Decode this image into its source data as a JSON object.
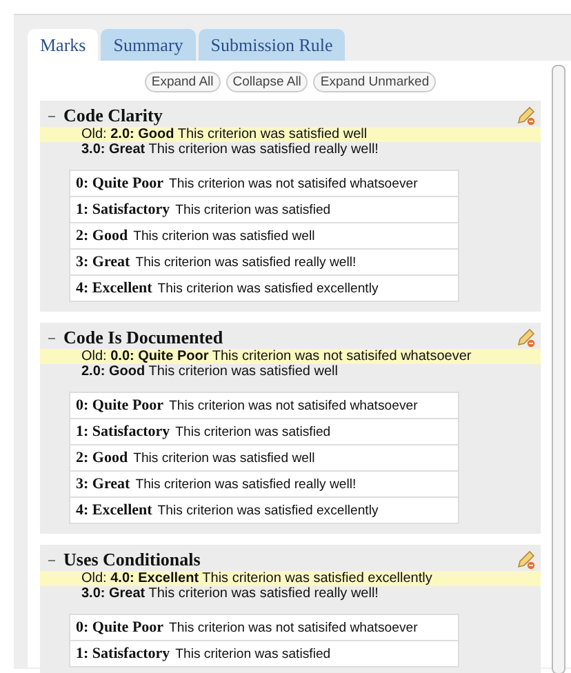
{
  "tabs": [
    {
      "label": "Marks",
      "selected": true
    },
    {
      "label": "Summary",
      "selected": false
    },
    {
      "label": "Submission Rule",
      "selected": false
    }
  ],
  "buttons": [
    "Expand All",
    "Collapse All",
    "Expand Unmarked"
  ],
  "criteria": [
    {
      "title": "Code Clarity",
      "expanded": true,
      "old_mark": "Old:  **2.0: Good**  This criterion was satisfied well",
      "new_mark": "**3.0: Great**  This criterion was satisfied really well!",
      "levels": [
        {
          "name": "0: Quite Poor",
          "description": "This criterion was not satisifed whatsoever"
        },
        {
          "name": "1: Satisfactory",
          "description": "This criterion was satisfied"
        },
        {
          "name": "2: Good",
          "description": "This criterion was satisfied well"
        },
        {
          "name": "3: Great",
          "description": "This criterion was satisfied really well!"
        },
        {
          "name": "4: Excellent",
          "description": "This criterion was satisfied excellently"
        }
      ]
    },
    {
      "title": "Code Is Documented",
      "expanded": true,
      "old_mark": "Old:  **0.0: Quite Poor**  This criterion was not satisifed whatsoever",
      "new_mark": "**2.0: Good**  This criterion was satisfied well",
      "levels": [
        {
          "name": "0: Quite Poor",
          "description": "This criterion was not satisifed whatsoever"
        },
        {
          "name": "1: Satisfactory",
          "description": "This criterion was satisfied"
        },
        {
          "name": "2: Good",
          "description": "This criterion was satisfied well"
        },
        {
          "name": "3: Great",
          "description": "This criterion was satisfied really well!"
        },
        {
          "name": "4: Excellent",
          "description": "This criterion was satisfied excellently"
        }
      ]
    },
    {
      "title": "Uses Conditionals",
      "expanded": true,
      "old_mark": "Old:  **4.0: Excellent**  This criterion was satisfied excellently",
      "new_mark": "**3.0: Great**  This criterion was satisfied really well!",
      "levels": [
        {
          "name": "0: Quite Poor",
          "description": "This criterion was not satisifed whatsoever"
        },
        {
          "name": "1: Satisfactory",
          "description": "This criterion was satisfied"
        }
      ]
    }
  ]
}
